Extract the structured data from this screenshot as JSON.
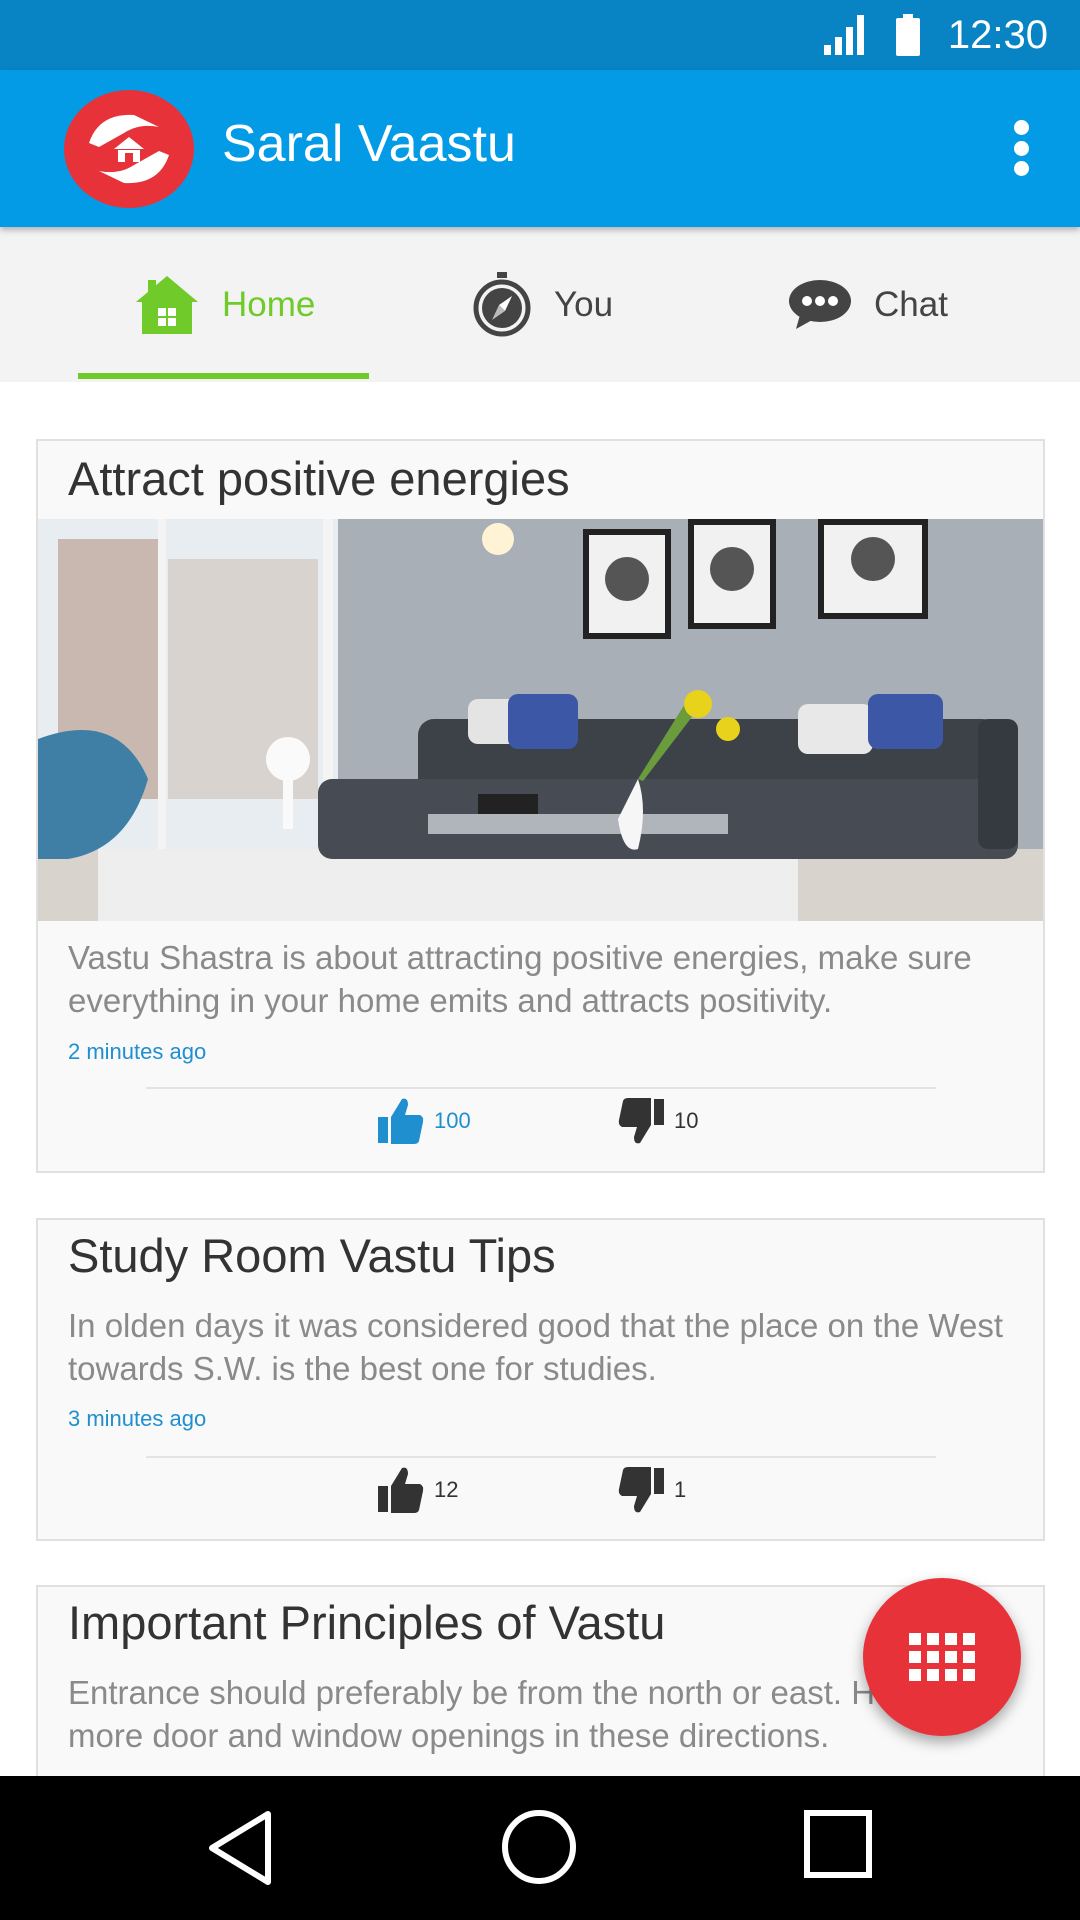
{
  "status_bar": {
    "time": "12:30"
  },
  "app_bar": {
    "title": "Saral Vaastu"
  },
  "tabs": [
    {
      "label": "Home",
      "icon": "home-icon",
      "active": true
    },
    {
      "label": "You",
      "icon": "compass-icon",
      "active": false
    },
    {
      "label": "Chat",
      "icon": "chat-bubble-icon",
      "active": false
    }
  ],
  "posts": [
    {
      "title": "Attract positive energies",
      "text": "Vastu Shastra is about attracting positive energies, make sure everything in your home emits and attracts positivity.",
      "time": "2 minutes ago",
      "likes": "100",
      "dislikes": "10",
      "image": "living-room-photo"
    },
    {
      "title": "Study Room Vastu Tips",
      "text": "In olden days it was considered good that the place on the West towards S.W. is the best one for studies.",
      "time": "3 minutes ago",
      "likes": "12",
      "dislikes": "1"
    },
    {
      "title": "Important Principles of Vastu",
      "text": "Entrance should preferably be from the north or east. Have more door and window openings in these directions."
    }
  ],
  "colors": {
    "status_bar": "#0884c4",
    "app_bar": "#039be5",
    "accent_green": "#6fca2a",
    "fab_red": "#e8323a",
    "link_blue": "#1f8fd0"
  }
}
